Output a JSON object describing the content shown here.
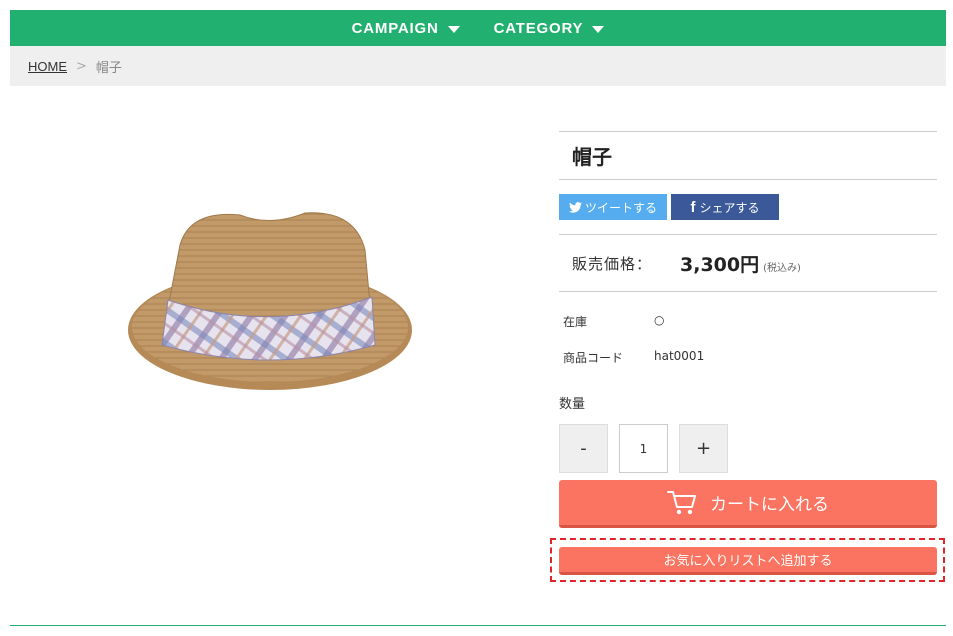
{
  "nav": {
    "items": [
      {
        "label": "CAMPAIGN"
      },
      {
        "label": "CATEGORY"
      }
    ]
  },
  "breadcrumb": {
    "home": "HOME",
    "separator": ">",
    "current": "帽子"
  },
  "product": {
    "title": "帽子",
    "share": {
      "tweet_label": "ツイートする",
      "facebook_label": "シェアする"
    },
    "price_label": "販売価格：",
    "price": "3,300円",
    "tax_note": "(税込み)",
    "specs": [
      {
        "label": "在庫",
        "value": "○"
      },
      {
        "label": "商品コード",
        "value": "hat0001"
      }
    ],
    "quantity": {
      "label": "数量",
      "minus": "-",
      "plus": "+",
      "value": "1"
    },
    "cart_button": "カートに入れる",
    "wishlist_button": "お気に入りリストへ追加する"
  },
  "colors": {
    "brand_green": "#22b070",
    "cta_coral": "#fa7461",
    "tweet_blue": "#55acee",
    "facebook_blue": "#3b5998",
    "highlight_dashed": "#e0252a"
  }
}
